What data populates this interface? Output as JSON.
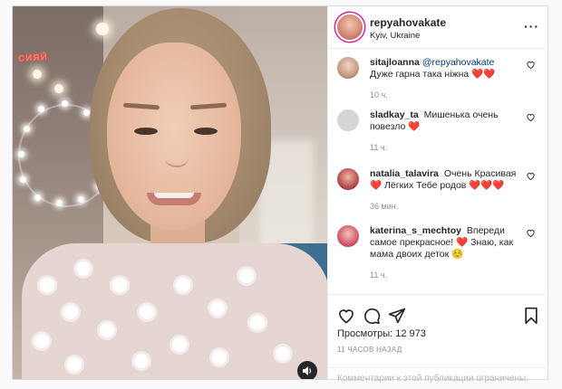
{
  "post": {
    "author": "repyahovakate",
    "location": "Kyiv, Ukraine"
  },
  "media": {
    "neon_sign_text": "СИЯЙ"
  },
  "comments": [
    {
      "user": "sitajloanna",
      "mention": "@repyahovakate",
      "text": "Дуже гарна така ніжна ❤️❤️",
      "time": "10 ч."
    },
    {
      "user": "sladkay_ta",
      "mention": "",
      "text": "Мишенька очень повезло ❤️",
      "time": "11 ч."
    },
    {
      "user": "natalia_talavira",
      "mention": "",
      "text": "Очень Красивая❤️ Лёгких Тебе родов ❤️❤️❤️",
      "time": "36 мин."
    },
    {
      "user": "katerina_s_mechtoy",
      "mention": "",
      "text": "Впереди самое прекрасное! ❤️ Знаю, как мама двоих деток ☺️",
      "time": "11 ч."
    }
  ],
  "actions": {
    "views_label": "Просмотры:",
    "views_count": "12 973",
    "posted_ago": "11 ЧАСОВ НАЗАД"
  },
  "comments_disabled_text": "Комментарии к этой публикации ограничены.",
  "colors": {
    "story_ring": "#d6249f",
    "link": "#00376b",
    "meta_gray": "#8e8e8e"
  }
}
